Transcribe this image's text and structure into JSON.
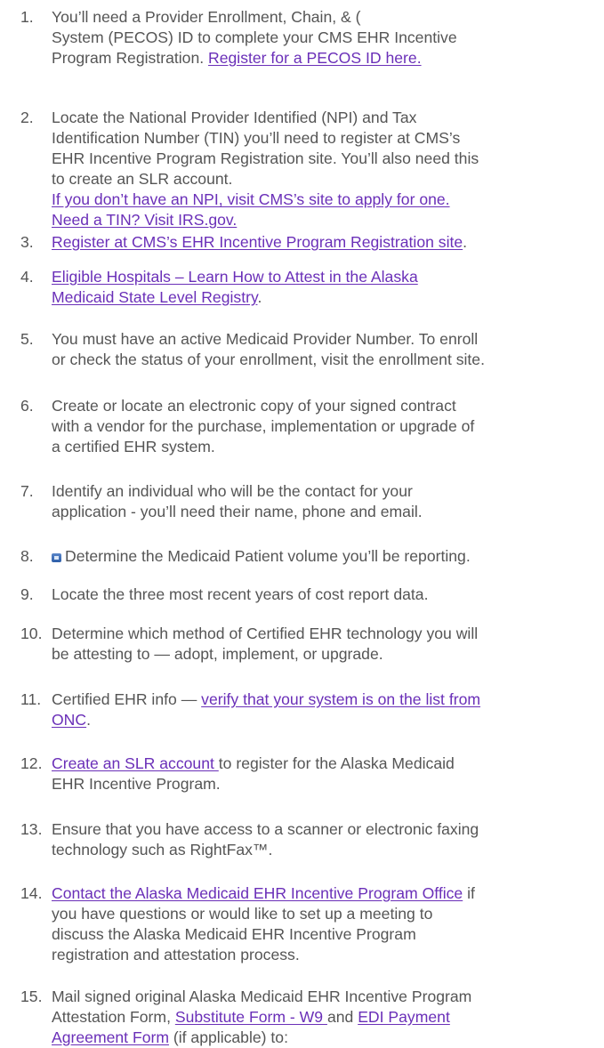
{
  "items": [
    {
      "num": "1.",
      "lines": [
        [
          {
            "t": "You’ll need a Provider Enrollment, Chain, & ("
          }
        ],
        [
          {
            "t": "System (PECOS) ID to complete your CMS EHR Incentive"
          }
        ],
        [
          {
            "t": "Program Registration. "
          },
          {
            "t": "Register for a PECOS ID here.",
            "link": true
          }
        ]
      ]
    },
    {
      "num": "2.",
      "lines": [
        [
          {
            "t": "Locate the National Provider Identified (NPI) and Tax"
          }
        ],
        [
          {
            "t": "Identification Number (TIN) you’ll need to register at CMS’s"
          }
        ],
        [
          {
            "t": "EHR Incentive Program Registration site. You’ll also need this"
          }
        ],
        [
          {
            "t": "to create an SLR account."
          }
        ],
        [
          {
            "t": "If you don’t have an NPI, visit CMS’s site to apply for one.",
            "link": true
          }
        ],
        [
          {
            "t": "Need a TIN? Visit IRS.gov.",
            "link": true
          }
        ]
      ]
    },
    {
      "num": "3.",
      "lines": [
        [
          {
            "t": "Register at CMS’s EHR Incentive Program Registration site",
            "link": true
          },
          {
            "t": "."
          }
        ]
      ]
    },
    {
      "num": "4.",
      "lines": [
        [
          {
            "t": "Eligible Hospitals – Learn How to Attest in the Alaska",
            "link": true
          }
        ],
        [
          {
            "t": "Medicaid State Level Registry",
            "link": true
          },
          {
            "t": "."
          }
        ]
      ]
    },
    {
      "num": "5.",
      "lines": [
        [
          {
            "t": "You must have an active Medicaid Provider Number. To enroll"
          }
        ],
        [
          {
            "t": "or check the status of your enrollment, visit the enrollment site."
          }
        ]
      ]
    },
    {
      "num": "6.",
      "lines": [
        [
          {
            "t": "Create or locate an electronic copy of your signed contract"
          }
        ],
        [
          {
            "t": "with a vendor for the purchase, implementation or upgrade of"
          }
        ],
        [
          {
            "t": "a certified EHR system."
          }
        ]
      ]
    },
    {
      "num": "7.",
      "lines": [
        [
          {
            "t": "Identify an individual who will be the contact for your"
          }
        ],
        [
          {
            "t": "application - you’ll need their name, phone and email."
          }
        ]
      ]
    },
    {
      "num": "8.",
      "icon": "document-icon",
      "lines": [
        [
          {
            "t": "Determine the Medicaid Patient volume you’ll be reporting."
          }
        ]
      ]
    },
    {
      "num": "9.",
      "lines": [
        [
          {
            "t": "Locate the three most recent years of cost report data."
          }
        ]
      ]
    },
    {
      "num": "10.",
      "lines": [
        [
          {
            "t": "Determine which method of Certified EHR technology you will"
          }
        ],
        [
          {
            "t": "be attesting to — adopt, implement, or upgrade."
          }
        ]
      ]
    },
    {
      "num": "11.",
      "lines": [
        [
          {
            "t": "Certified EHR info — "
          },
          {
            "t": "verify that your system is on the list from",
            "link": true
          }
        ],
        [
          {
            "t": "ONC",
            "link": true
          },
          {
            "t": "."
          }
        ]
      ]
    },
    {
      "num": "12.",
      "lines": [
        [
          {
            "t": "Create an SLR account ",
            "link": true
          },
          {
            "t": "to register for the Alaska Medicaid"
          }
        ],
        [
          {
            "t": "EHR Incentive Program."
          }
        ]
      ]
    },
    {
      "num": "13.",
      "lines": [
        [
          {
            "t": "Ensure that you have access to a scanner or electronic faxing"
          }
        ],
        [
          {
            "t": "technology such as RightFax™."
          }
        ]
      ]
    },
    {
      "num": "14.",
      "lines": [
        [
          {
            "t": "Contact the Alaska Medicaid EHR Incentive Program Office",
            "link": true
          },
          {
            "t": " if"
          }
        ],
        [
          {
            "t": "you have questions or would like to set up a meeting to"
          }
        ],
        [
          {
            "t": "discuss the Alaska Medicaid EHR Incentive Program"
          }
        ],
        [
          {
            "t": "registration and attestation process."
          }
        ]
      ]
    },
    {
      "num": "15.",
      "lines": [
        [
          {
            "t": "Mail signed original Alaska Medicaid EHR Incentive Program"
          }
        ],
        [
          {
            "t": "Attestation Form, "
          },
          {
            "t": "Substitute Form - W9 ",
            "link": true
          },
          {
            "t": "and "
          },
          {
            "t": "EDI Payment",
            "link": true
          }
        ],
        [
          {
            "t": "Agreement Form",
            "link": true
          },
          {
            "t": " (if applicable) to:"
          }
        ]
      ]
    }
  ],
  "colors": {
    "text": "#555555",
    "link": "#6a2fb8"
  }
}
